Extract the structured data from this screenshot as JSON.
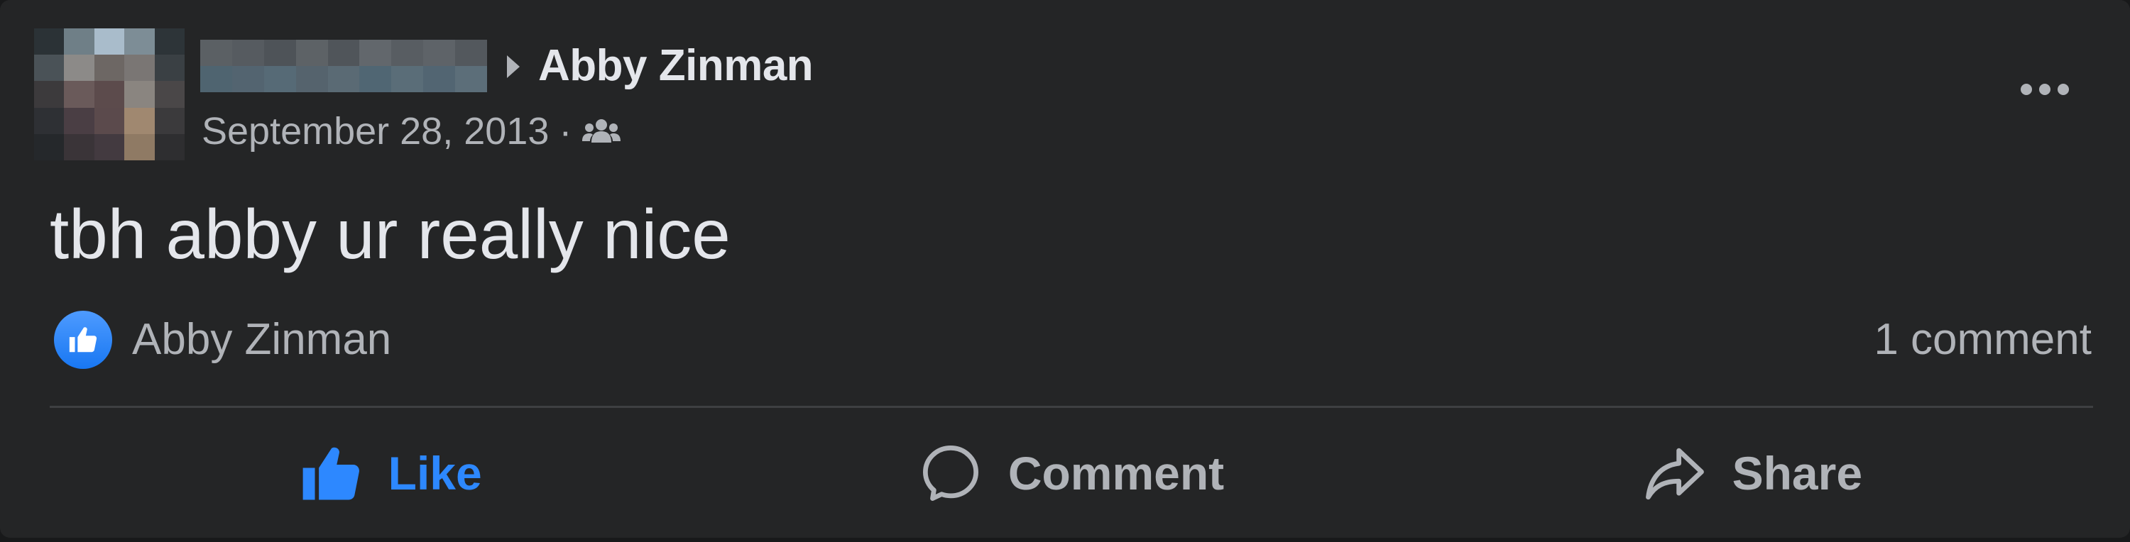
{
  "post": {
    "target_name": "Abby Zinman",
    "date": "September 28, 2013",
    "separator": "·",
    "audience_icon": "friends-icon",
    "text": "tbh abby ur really nice"
  },
  "reactions": {
    "icon": "like-icon",
    "reactor_name": "Abby Zinman",
    "comment_count": "1 comment"
  },
  "actions": {
    "like_label": "Like",
    "comment_label": "Comment",
    "share_label": "Share"
  },
  "colors": {
    "background": "#242526",
    "primary_text": "#e4e6eb",
    "secondary_text": "#b0b3b8",
    "accent_blue": "#2d88ff",
    "divider": "#3e4042"
  }
}
